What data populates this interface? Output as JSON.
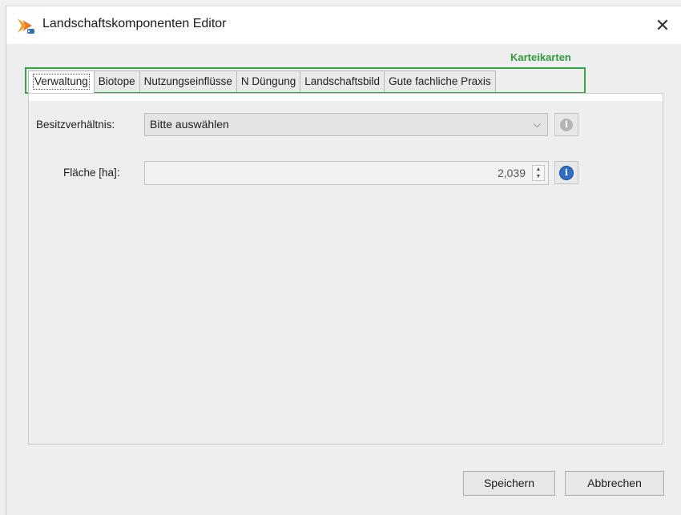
{
  "window": {
    "title": "Landschaftskomponenten Editor",
    "close_glyph": "✕"
  },
  "annotation": {
    "label": "Karteikarten",
    "color": "#2f9b3a"
  },
  "tabs": [
    {
      "label": "Verwaltung",
      "active": true
    },
    {
      "label": "Biotope"
    },
    {
      "label": "Nutzungseinflüsse"
    },
    {
      "label": "N Düngung"
    },
    {
      "label": "Landschaftsbild"
    },
    {
      "label": "Gute fachliche Praxis"
    }
  ],
  "form": {
    "ownership": {
      "label": "Besitzverhältnis:",
      "value": "Bitte auswählen",
      "arrow": "⌵",
      "info_glyph": "i",
      "info_icon": "info-icon-disabled"
    },
    "area": {
      "label": "Fläche [ha]:",
      "value": "2,039",
      "info_glyph": "i",
      "info_icon": "info-icon"
    }
  },
  "buttons": {
    "save": "Speichern",
    "cancel": "Abbrechen"
  },
  "colors": {
    "accent_green": "#3aa34a",
    "info_blue": "#2e6fc4",
    "info_disabled": "#b5b5b5"
  }
}
